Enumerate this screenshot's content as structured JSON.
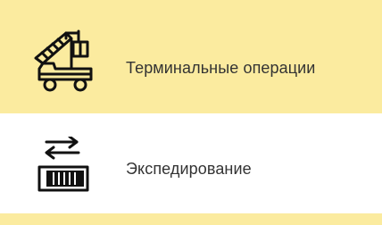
{
  "colors": {
    "active_bg": "#fbeb9f",
    "normal_bg": "#ffffff",
    "icon": "#111111",
    "text": "#333333"
  },
  "menu": {
    "items": [
      {
        "label": "Терминальные операции",
        "icon": "forklift-loader-icon",
        "active": true
      },
      {
        "label": "Экспедирование",
        "icon": "container-transfer-icon",
        "active": false
      }
    ]
  }
}
